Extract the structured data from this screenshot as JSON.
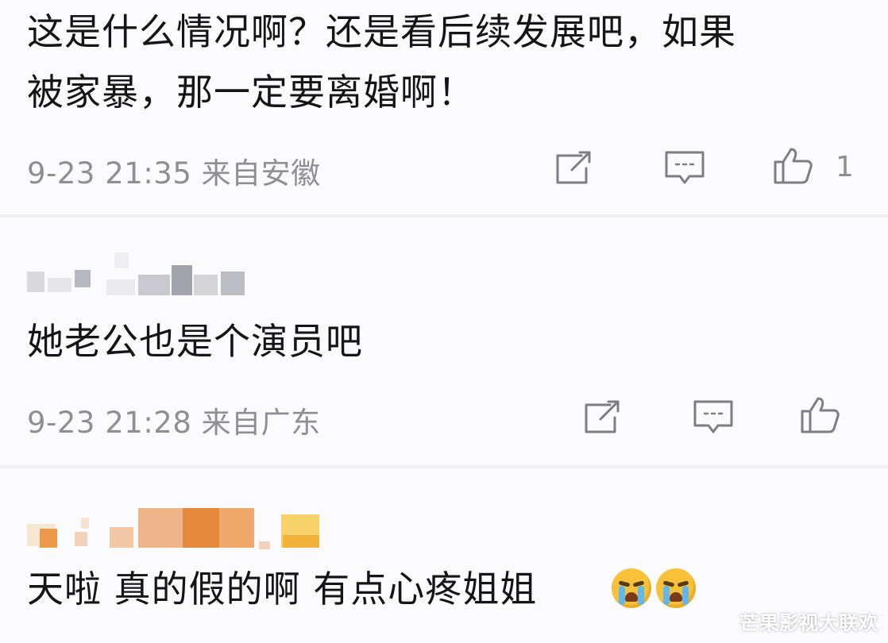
{
  "comments": [
    {
      "text": "这是什么情况啊？还是看后续发展吧，如果\n被家暴，那一定要离婚啊！",
      "meta": "9-23 21:35 来自安徽",
      "like_count": "1"
    },
    {
      "text": "她老公也是个演员吧",
      "meta": "9-23 21:28 来自广东"
    },
    {
      "text": "天啦 真的假的啊 有点心疼姐姐"
    }
  ],
  "icons": {
    "share": "share-icon",
    "reply": "reply-icon",
    "like": "thumbs-up-icon",
    "emoji": "crying-face-emoji"
  },
  "colors": {
    "text": "#151515",
    "meta": "#8e8e96",
    "background": "#fbfbfd",
    "accent_orange": "#e58a3a"
  },
  "watermark": "芒果影视大联欢"
}
